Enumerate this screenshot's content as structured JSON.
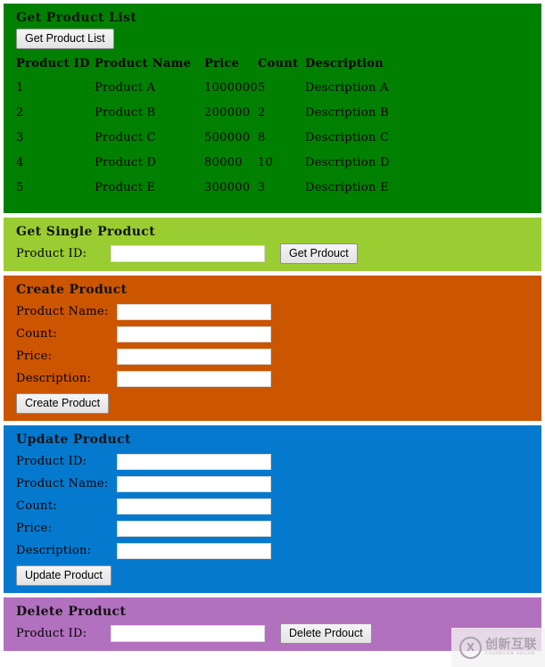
{
  "sections": {
    "list": {
      "title": "Get Product List",
      "button_label": "Get Product List",
      "accent": "#008000",
      "table": {
        "columns": [
          "Product ID",
          "Product Name",
          "Price",
          "Count",
          "Description"
        ],
        "rows": [
          [
            "1",
            "Product A",
            "1000000",
            "5",
            "Description A"
          ],
          [
            "2",
            "Product B",
            "200000",
            "2",
            "Description B"
          ],
          [
            "3",
            "Product C",
            "500000",
            "8",
            "Description C"
          ],
          [
            "4",
            "Product D",
            "80000",
            "10",
            "Description D"
          ],
          [
            "5",
            "Product E",
            "300000",
            "3",
            "Description E"
          ]
        ]
      }
    },
    "single": {
      "title": "Get Single Product",
      "accent": "#9ACD32",
      "label_product_id": "Product ID:",
      "value_product_id": "",
      "button_label": "Get Prdouct"
    },
    "create": {
      "title": "Create Product",
      "accent": "#CC5500",
      "fields": [
        {
          "label": "Product Name:",
          "value": ""
        },
        {
          "label": "Count:",
          "value": ""
        },
        {
          "label": "Price:",
          "value": ""
        },
        {
          "label": "Description:",
          "value": ""
        }
      ],
      "button_label": "Create Product"
    },
    "update": {
      "title": "Update Product",
      "accent": "#0579CE",
      "fields": [
        {
          "label": "Product ID:",
          "value": ""
        },
        {
          "label": "Product Name:",
          "value": ""
        },
        {
          "label": "Count:",
          "value": ""
        },
        {
          "label": "Price:",
          "value": ""
        },
        {
          "label": "Description:",
          "value": ""
        }
      ],
      "button_label": "Update Product"
    },
    "delete": {
      "title": "Delete Product",
      "accent": "#B271BE",
      "label_product_id": "Product ID:",
      "value_product_id": "",
      "button_label": "Delete Prdouct"
    }
  },
  "watermark": {
    "mark": "X",
    "name_cn": "创新互联",
    "name_en": "CHUANGXIN HULIAN"
  }
}
